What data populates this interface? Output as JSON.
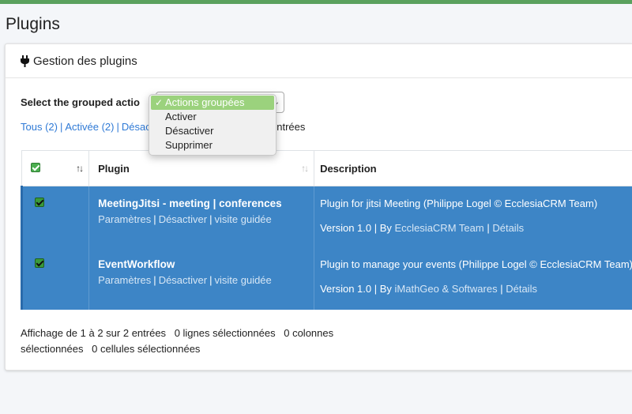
{
  "page": {
    "title": "Plugins"
  },
  "card": {
    "header": "Gestion des plugins"
  },
  "grouped": {
    "label": "Select the grouped actio",
    "options": [
      "Actions groupées",
      "Activer",
      "Désactiver",
      "Supprimer"
    ],
    "selected": "Actions groupées"
  },
  "filters": {
    "all": "Tous (2)",
    "active": "Activée (2)",
    "inactive_partial": "Désac",
    "entries_partial": "entrées"
  },
  "table": {
    "headers": {
      "plugin": "Plugin",
      "description": "Description"
    },
    "rows": [
      {
        "name": "MeetingJitsi - meeting | conferences",
        "links": [
          "Paramètres",
          "Désactiver",
          "visite guidée"
        ],
        "description": "Plugin for jitsi Meeting (Philippe Logel © EcclesiaCRM Team)",
        "version": "Version 1.0 | By",
        "author": "EcclesiaCRM Team",
        "details": "Détails"
      },
      {
        "name": "EventWorkflow",
        "links": [
          "Paramètres",
          "Désactiver",
          "visite guidée"
        ],
        "description": "Plugin to manage your events (Philippe Logel © EcclesiaCRM Team)",
        "version": "Version 1.0 | By",
        "author": "iMathGeo & Softwares",
        "details": "Détails"
      }
    ]
  },
  "info": {
    "showing": "Affichage de 1 à 2 sur 2 entrées",
    "rows_selected": "0 lignes sélectionnées",
    "cols_selected": "0 colonnes sélectionnées",
    "cells_selected": "0 cellules sélectionnées"
  },
  "colors": {
    "accent": "#3d85c6",
    "topbar": "#5aa15e",
    "selected_option": "#9bd27d",
    "link": "#2f7ad6"
  }
}
